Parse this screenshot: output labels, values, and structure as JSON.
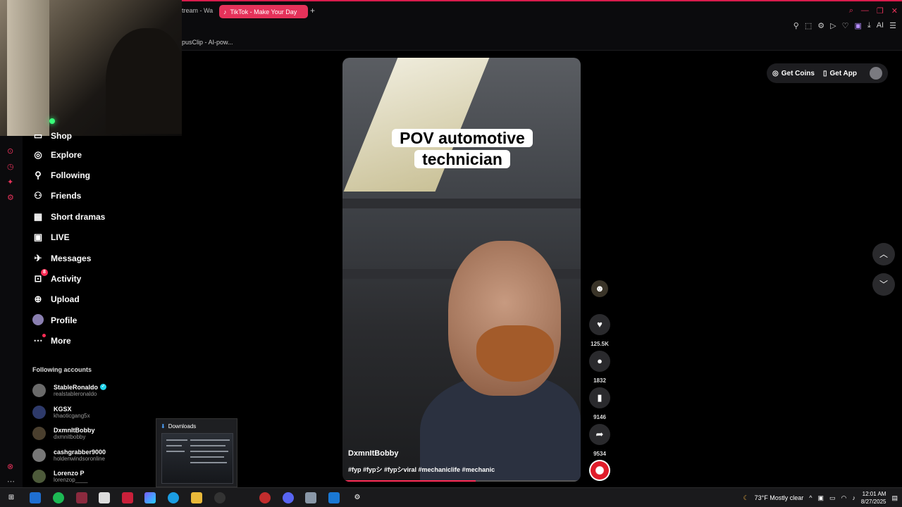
{
  "browser": {
    "prev_tab_label": "tream - Wa",
    "active_tab_label": "TikTok - Make Your Day",
    "new_tab_icon": "plus-icon",
    "bookmark_label": "pusClip - AI-pow...",
    "toolbar_ai_label": "AI"
  },
  "sidebar": {
    "partial_item": "Shop",
    "items": [
      {
        "label": "Explore",
        "icon": "compass-icon"
      },
      {
        "label": "Following",
        "icon": "following-icon"
      },
      {
        "label": "Friends",
        "icon": "friends-icon"
      },
      {
        "label": "Short dramas",
        "icon": "film-icon"
      },
      {
        "label": "LIVE",
        "icon": "live-icon"
      },
      {
        "label": "Messages",
        "icon": "messages-icon"
      },
      {
        "label": "Activity",
        "icon": "inbox-icon",
        "badge": "8"
      },
      {
        "label": "Upload",
        "icon": "upload-icon"
      },
      {
        "label": "Profile",
        "icon": "profile-avatar"
      },
      {
        "label": "More",
        "icon": "more-icon"
      }
    ],
    "following_title": "Following accounts",
    "accounts": [
      {
        "name": "StableRonaldo",
        "handle": "realstableronaldo",
        "verified": true
      },
      {
        "name": "KGSX",
        "handle": "khaoticgang5x",
        "verified": false
      },
      {
        "name": "DxmnItBobby",
        "handle": "dxmnitbobby",
        "verified": false
      },
      {
        "name": "cashgrabber9000",
        "handle": "holdenwindsoronline",
        "verified": false
      },
      {
        "name": "Lorenzo P",
        "handle": "lorenzop____",
        "verified": false
      }
    ]
  },
  "header": {
    "get_coins_label": "Get Coins",
    "get_app_label": "Get App"
  },
  "video": {
    "caption_line1": "POV automotive",
    "caption_line2": "technician",
    "username": "DxmnItBobby",
    "hashtags": "#fyp #fypシ #fypシviral #mechaniclife #mechanic",
    "progress_fraction": 0.56
  },
  "actions": {
    "likes": "125.5K",
    "comments": "1832",
    "bookmarks": "9146",
    "shares": "9534"
  },
  "downloads_popup": {
    "title": "Downloads"
  },
  "taskbar": {
    "weather": "73°F  Mostly clear",
    "time": "12:01 AM",
    "date": "8/27/2025"
  }
}
